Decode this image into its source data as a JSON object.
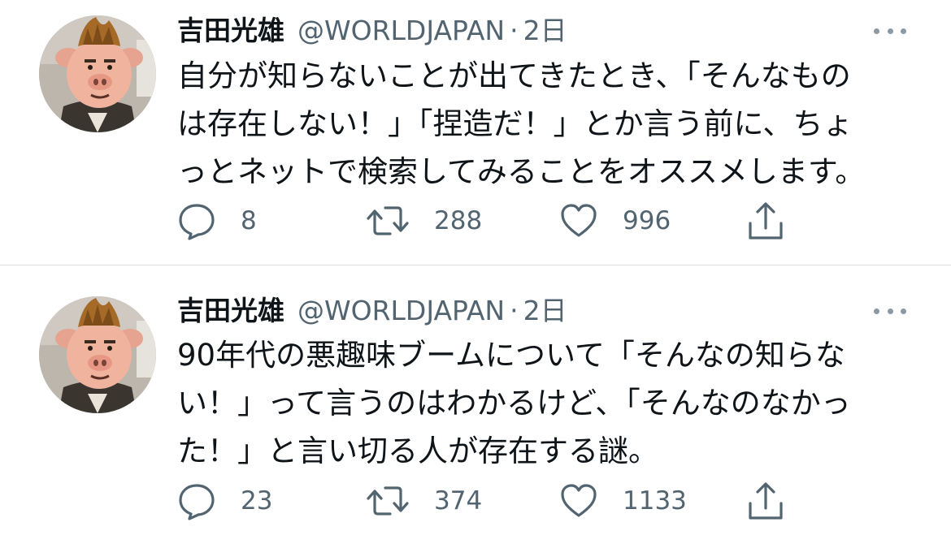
{
  "tweets": [
    {
      "author_name": "吉田光雄",
      "handle": "@WORLDJAPAN",
      "separator": "·",
      "time": "2日",
      "lines": [
        "自分が知らないことが出てきたとき、「そんなもの",
        "は存在しない！」「捏造だ！」とか言う前に、ちょ",
        "っとネットで検索してみることをオススメします。"
      ],
      "replies": "8",
      "retweets": "288",
      "likes": "996"
    },
    {
      "author_name": "吉田光雄",
      "handle": "@WORLDJAPAN",
      "separator": "·",
      "time": "2日",
      "lines": [
        "90年代の悪趣味ブームについて「そんなの知らな",
        "い！」って言うのはわかるけど、「そんなのなかっ",
        "た！」と言い切る人が存在する謎。"
      ],
      "replies": "23",
      "retweets": "374",
      "likes": "1133"
    }
  ],
  "icons": {
    "avatar": "pig-avatar",
    "more": "more-icon",
    "reply": "reply-icon",
    "retweet": "retweet-icon",
    "like": "like-icon",
    "share": "share-icon"
  },
  "colors": {
    "text": "#0f1419",
    "secondary": "#536471",
    "divider": "#d9dde1"
  }
}
